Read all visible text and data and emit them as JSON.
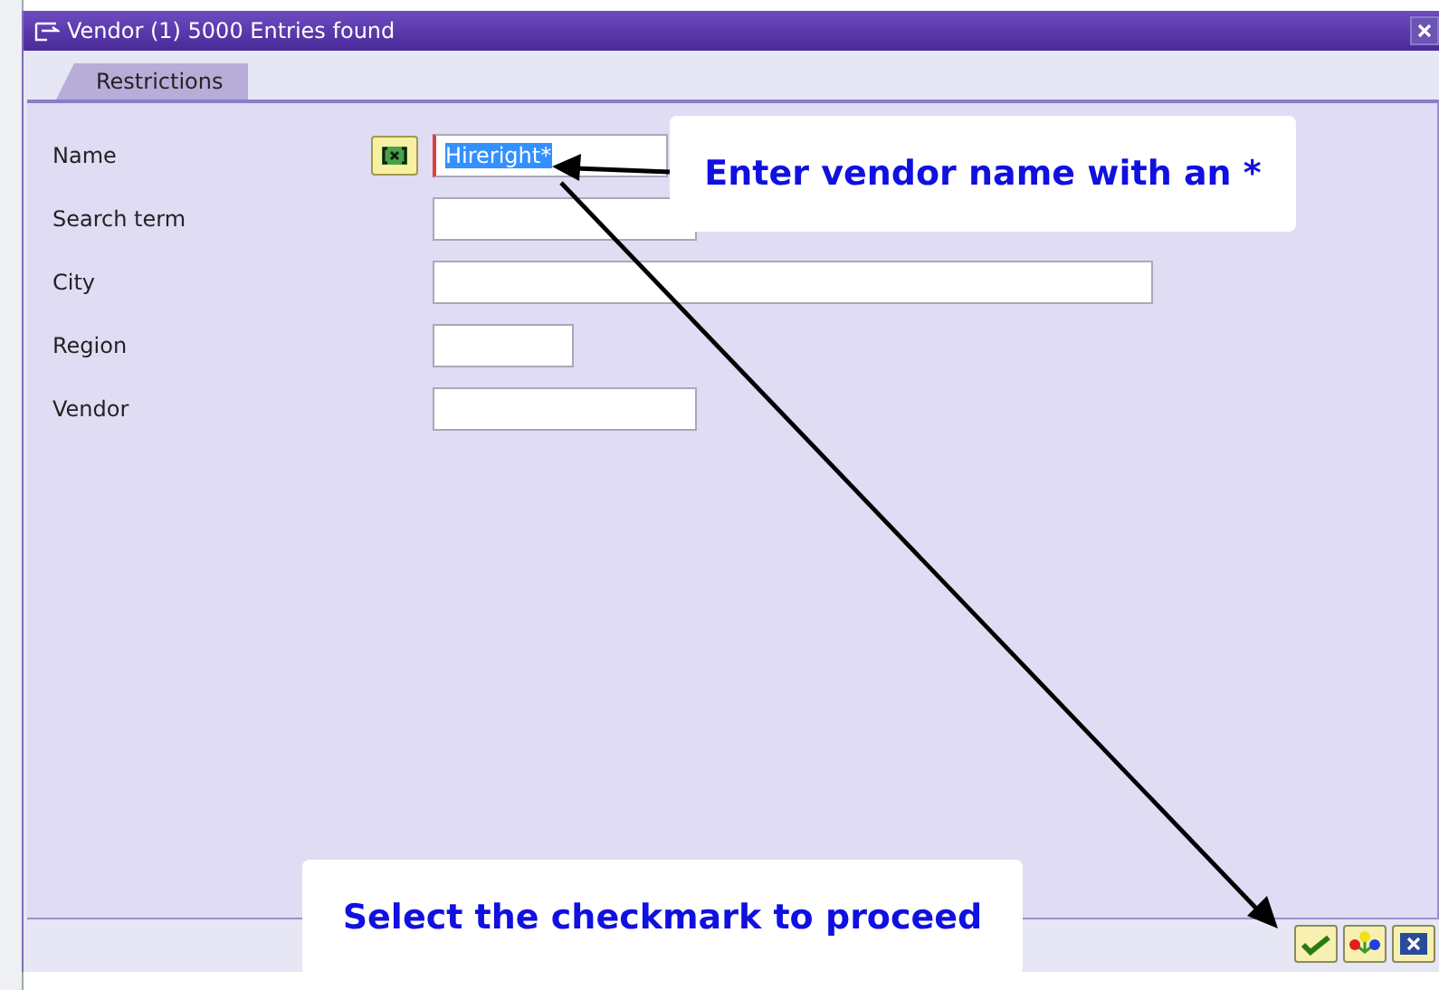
{
  "window": {
    "title": "Vendor (1) 5000 Entries found"
  },
  "tabs": [
    {
      "label": "Restrictions",
      "selected": true
    }
  ],
  "fields": [
    {
      "label": "Name",
      "kind": "multiselect",
      "value": "Hireright*",
      "value_selected": true
    },
    {
      "label": "Search term",
      "kind": "plain"
    },
    {
      "label": "City",
      "kind": "plain"
    },
    {
      "label": "Region",
      "kind": "plain"
    },
    {
      "label": "Vendor",
      "kind": "plain"
    }
  ],
  "buttons": [
    {
      "kind": "confirm"
    },
    {
      "kind": "hierarchy"
    },
    {
      "kind": "cancel"
    }
  ],
  "callouts": [
    {
      "text": "Enter vendor name with an *"
    },
    {
      "text": "Select the checkmark to proceed"
    }
  ]
}
